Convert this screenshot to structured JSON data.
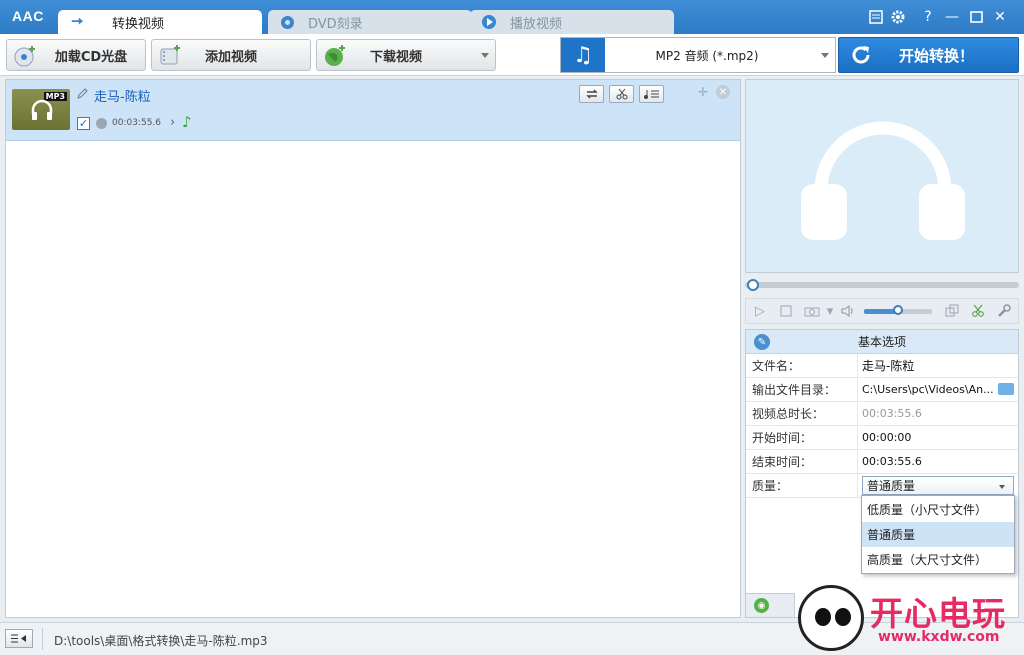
{
  "app": {
    "logo": "AAC"
  },
  "tabs": [
    {
      "label": "转换视频",
      "active": true
    },
    {
      "label": "DVD刻录",
      "active": false
    },
    {
      "label": "播放视频",
      "active": false
    }
  ],
  "window_controls": {
    "help": "?",
    "minimize": "—",
    "close": "✕"
  },
  "toolbar": {
    "load_cd": "加载CD光盘",
    "add_video": "添加视频",
    "download_video": "下载视频",
    "format": "MP2 音频 (*.mp2)",
    "start": "开始转换！"
  },
  "file_list": {
    "items": [
      {
        "title": "走马-陈粒",
        "duration": "00:03:55.6",
        "thumb_tag": "MP3",
        "checked": true
      }
    ]
  },
  "player": {
    "seek_progress": 0.0,
    "volume": 0.5
  },
  "properties": {
    "header": "基本选项",
    "rows": [
      {
        "label": "文件名：",
        "value": "走马-陈粒"
      },
      {
        "label": "输出文件目录：",
        "value": "C:\\Users\\pc\\Videos\\An..."
      },
      {
        "label": "视频总时长：",
        "value": "00:03:55.6"
      },
      {
        "label": "开始时间：",
        "value": "00:00:00"
      },
      {
        "label": "结束时间：",
        "value": "00:03:55.6"
      },
      {
        "label": "质量：",
        "value": "普通质量"
      }
    ],
    "quality_options": [
      "低质量（小尺寸文件）",
      "普通质量",
      "高质量（大尺寸文件）"
    ],
    "quality_selected_index": 1
  },
  "status": {
    "path": "D:\\tools\\桌面\\格式转换\\走马-陈粒.mp3"
  },
  "watermark": {
    "text": "开心电玩",
    "url": "www.kxdw.com"
  },
  "colors": {
    "accent": "#2f7bc6",
    "start_button": "#1f74c8",
    "selected_row": "#cde3f7",
    "preview_bg": "#d9ecf8",
    "watermark": "#e62a64"
  }
}
